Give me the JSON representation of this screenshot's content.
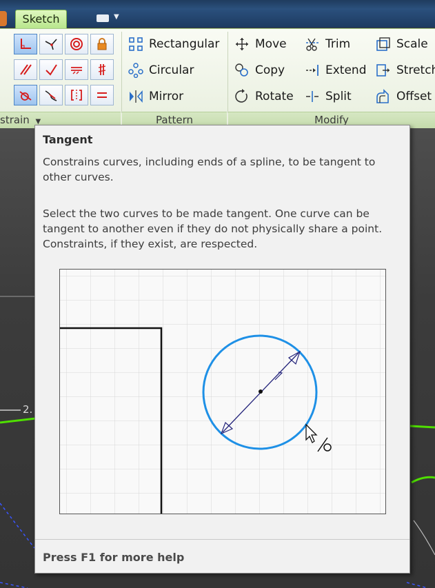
{
  "tabs": {
    "active": "Sketch"
  },
  "ribbon": {
    "constrain_panel": {
      "label": "Constrain",
      "label_visible": "strain"
    },
    "pattern_panel": {
      "label": "Pattern",
      "buttons": [
        {
          "label": "Rectangular",
          "icon": "rectangular-pattern-icon"
        },
        {
          "label": "Circular",
          "icon": "circular-pattern-icon"
        },
        {
          "label": "Mirror",
          "icon": "mirror-icon"
        }
      ]
    },
    "modify_panel": {
      "label": "Modify",
      "buttons": [
        {
          "label": "Move",
          "icon": "move-icon"
        },
        {
          "label": "Trim",
          "icon": "trim-icon"
        },
        {
          "label": "Scale",
          "icon": "scale-icon"
        },
        {
          "label": "Copy",
          "icon": "copy-icon"
        },
        {
          "label": "Extend",
          "icon": "extend-icon"
        },
        {
          "label": "Stretch",
          "icon": "stretch-icon"
        },
        {
          "label": "Rotate",
          "icon": "rotate-icon"
        },
        {
          "label": "Split",
          "icon": "split-icon"
        },
        {
          "label": "Offset",
          "icon": "offset-icon"
        }
      ]
    }
  },
  "viewport": {
    "dimension_label": "2."
  },
  "tooltip": {
    "title": "Tangent",
    "description": "Constrains curves, including ends of a spline, to be tangent to other curves.",
    "detail": "Select the two curves to be made tangent. One curve can be tangent to another even if they do not physically share a point. Constraints, if they exist, are respected.",
    "footer": "Press F1 for more help"
  },
  "colors": {
    "sketch_tab": "#b8e68c",
    "circle_blue": "#1e90e6",
    "arrow_navy": "#23237a",
    "sketch_green": "#4fe000",
    "panel_label_bg": "#c4dbab"
  }
}
